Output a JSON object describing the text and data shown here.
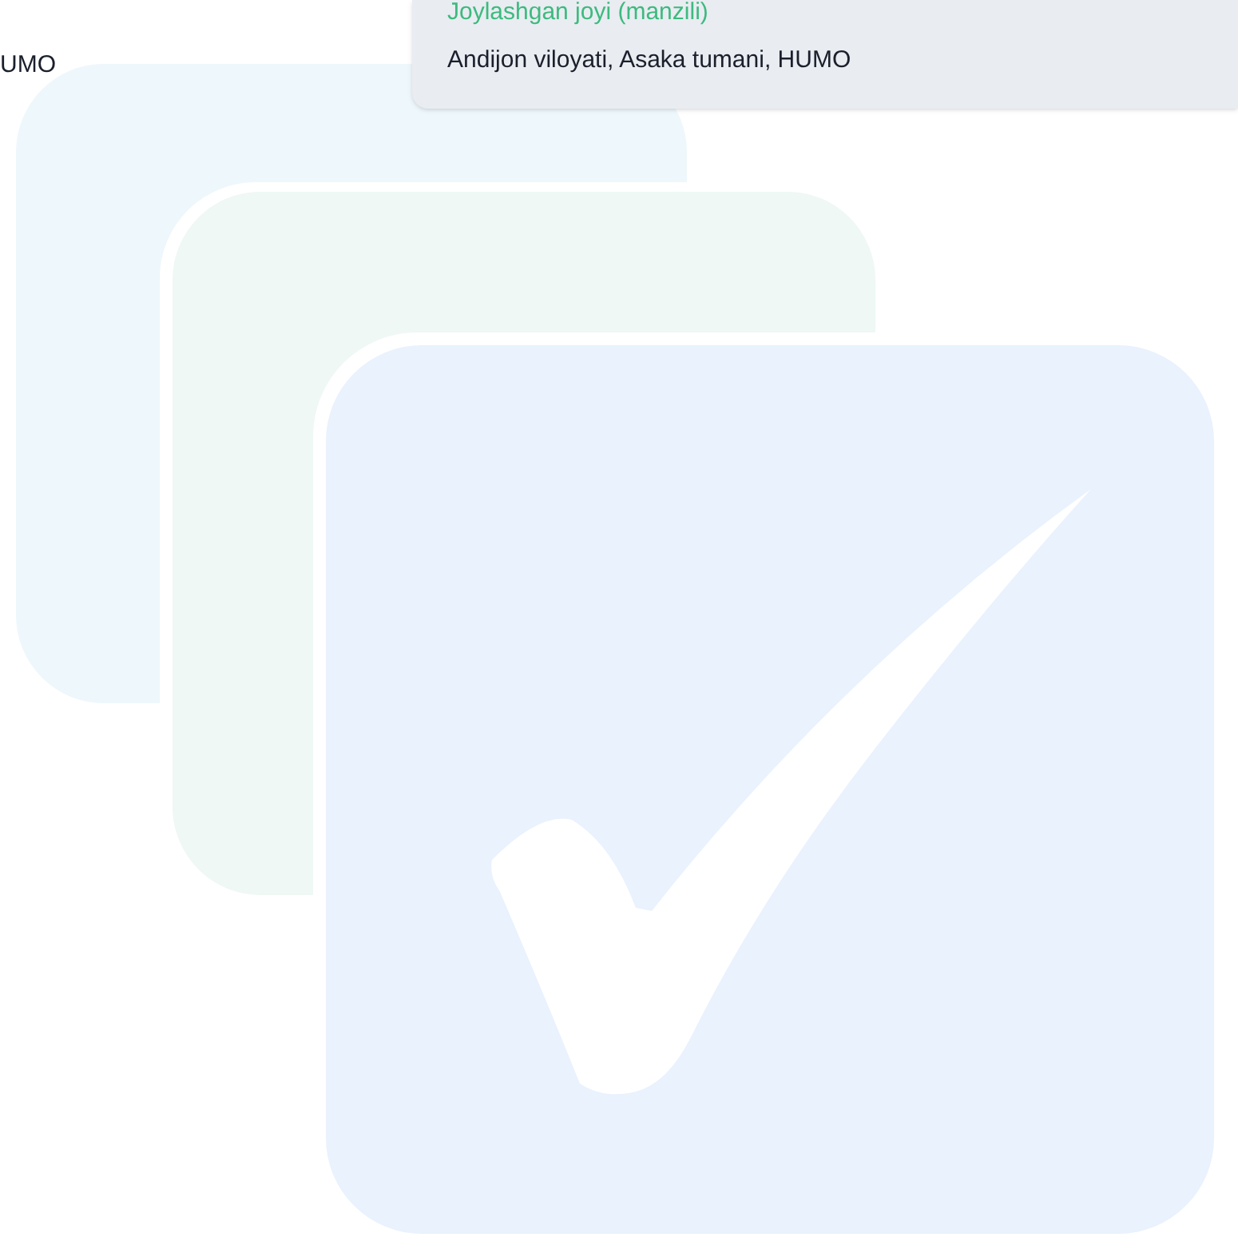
{
  "left_fragment": "UMO",
  "location_card": {
    "label": "Joylashgan joyi (manzili)",
    "value": "Andijon viloyati, Asaka tumani, HUMO"
  }
}
